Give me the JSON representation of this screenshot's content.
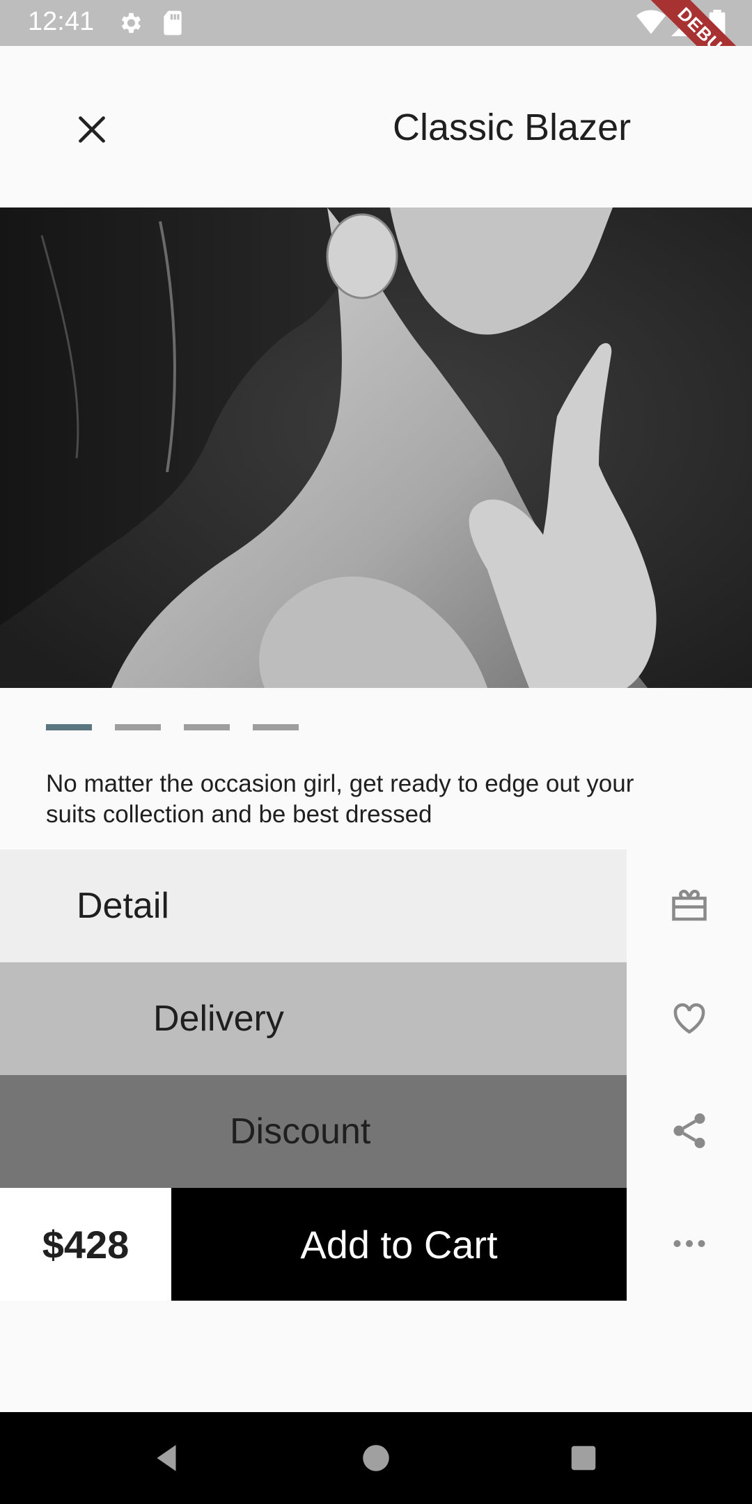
{
  "status_bar": {
    "time": "12:41",
    "icons": [
      "gear-icon",
      "sd-card-icon",
      "wifi-icon",
      "signal-icon",
      "battery-icon"
    ],
    "debug_label": "DEBUG"
  },
  "app_bar": {
    "title": "Classic Blazer",
    "close_icon": "close-icon"
  },
  "product": {
    "image_alt": "product photo",
    "carousel": {
      "count": 4,
      "active_index": 0
    },
    "description": "No matter the occasion girl, get ready to edge out your suits collection and be best dressed"
  },
  "menu": {
    "detail_label": "Detail",
    "delivery_label": "Delivery",
    "discount_label": "Discount"
  },
  "cart": {
    "price": "$428",
    "add_to_cart_label": "Add to Cart"
  },
  "side_actions": [
    "gift-card-icon",
    "heart-icon",
    "share-icon",
    "more-horiz-icon"
  ],
  "colors": {
    "status_bar": "#bdbdbd",
    "indicator_active": "#5a7680",
    "indicator_inactive": "#9e9e9e",
    "row_detail": "#eeeeee",
    "row_delivery": "#bdbdbd",
    "row_discount": "#757575",
    "cart_button": "#000000",
    "debug_ribbon": "#a83232"
  }
}
